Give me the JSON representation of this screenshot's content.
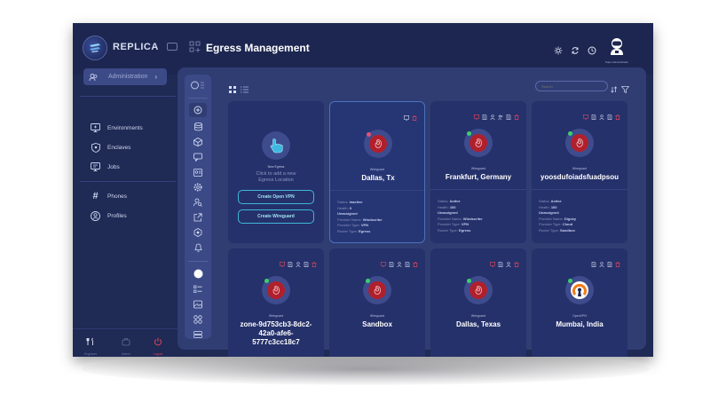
{
  "app": {
    "name": "REPLICA"
  },
  "header": {
    "title": "Egress Management",
    "user_caption": "Super Administrator"
  },
  "sidebar": {
    "admin_label": "Administration",
    "items": [
      {
        "label": "Environments",
        "icon": "monitor-icon"
      },
      {
        "label": "Enclaves",
        "icon": "shield-icon"
      },
      {
        "label": "Jobs",
        "icon": "monitor-jobs-icon"
      },
      {
        "label": "Phones",
        "icon": "hash-icon"
      },
      {
        "label": "Profiles",
        "icon": "profile-icon"
      }
    ],
    "bottom": [
      {
        "label": "Engineer"
      },
      {
        "label": "Admin"
      },
      {
        "label": "Logout"
      }
    ]
  },
  "toolbar": {
    "search_placeholder": "Search"
  },
  "new_egress": {
    "title": "New Egress",
    "subtitle_line1": "Click to add a new",
    "subtitle_line2": "Egress Location",
    "button_openvpn": "Create Open VPN",
    "button_wireguard": "Create Wireguard"
  },
  "colors": {
    "accent": "#3fb8d8",
    "status_active": "#3ccf6a",
    "status_inactive": "#e0527a",
    "action_delete": "#e0445a",
    "wireguard_red": "#b0202c",
    "openvpn_orange": "#f07a1a"
  },
  "detail_labels": {
    "status": "Status:",
    "health": "Health:",
    "unassigned": "Unassigned",
    "provider_name": "Provider Name:",
    "provider_type": "Provider Type:",
    "router_type": "Router Type:"
  },
  "cards": [
    {
      "type": "Wireguard",
      "name": "Dallas, Tx",
      "selected": true,
      "status_dot": "inactive",
      "status": "Inactive",
      "health": "0",
      "provider_name": "Windscribe",
      "provider_type": "VPN",
      "router_type": "Egress"
    },
    {
      "type": "Wireguard",
      "name": "Frankfurt, Germany",
      "selected": false,
      "status_dot": "active",
      "status": "Active",
      "health": "100",
      "provider_name": "Windscribe",
      "provider_type": "VPN",
      "router_type": "Egress"
    },
    {
      "type": "Wireguard",
      "name": "yoosdufoiadsfuadpsou",
      "selected": false,
      "status_dot": "active",
      "status": "Active",
      "health": "100",
      "provider_name": "Digsky",
      "provider_type": "Cloud",
      "router_type": "Sandbox"
    },
    {
      "type": "Wireguard",
      "name_line1": "zone-9d753cb3-8dc2-",
      "name_line2": "42a0-afe6-",
      "name_line3": "5777c3cc18c7",
      "status_dot": "active"
    },
    {
      "type": "Wireguard",
      "name": "Sandbox",
      "status_dot": "active"
    },
    {
      "type": "Wireguard",
      "name": "Dallas, Texas",
      "status_dot": "active"
    },
    {
      "type": "OpenVPN",
      "name": "Mumbai, India",
      "status_dot": "active"
    }
  ]
}
